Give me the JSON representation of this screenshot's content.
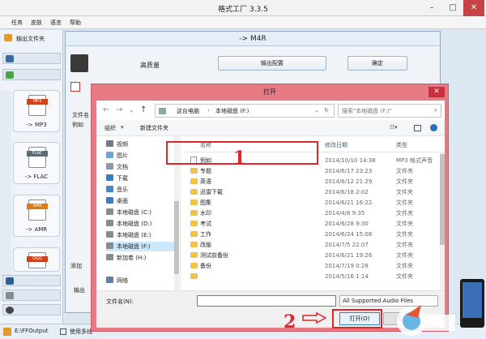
{
  "app": {
    "title": "格式工厂 3.3.5"
  },
  "menu": [
    "任务",
    "皮肤",
    "语言",
    "帮助"
  ],
  "toolbar": {
    "output_folder": "输出文件夹"
  },
  "left": {
    "formats": [
      {
        "label": "-> MP3",
        "tag": "MP3",
        "color": "#d0421b"
      },
      {
        "label": "-> FLAC",
        "tag": "FLAC",
        "color": "#5a6b7a"
      },
      {
        "label": "-> AMR",
        "tag": "AMR",
        "color": "#e07a10"
      },
      {
        "label": "OGG",
        "tag": "OGG",
        "color": "#d0421b"
      }
    ]
  },
  "m4r": {
    "title": "-> M4R",
    "quality_label": "高质量",
    "output_settings_btn": "输出配置",
    "ok_btn": "确定",
    "file_name_label": "文件名",
    "file_item": "例如",
    "add_label": "添加",
    "output_label": "输出"
  },
  "open_dialog": {
    "title": "打开",
    "close": "✕",
    "address": {
      "pc": "这台电脑",
      "drive": "本地磁盘 (F:)"
    },
    "search_placeholder": "搜索\"本地磁盘 (F:)\"",
    "organize": "组织",
    "new_folder": "新建文件夹",
    "nav": [
      {
        "label": "视频",
        "color": "#6d7b8c"
      },
      {
        "label": "图片",
        "color": "#6aa7d6"
      },
      {
        "label": "文档",
        "color": "#8a9aa9"
      },
      {
        "label": "下载",
        "color": "#3a7fc6"
      },
      {
        "label": "音乐",
        "color": "#4a86c8"
      },
      {
        "label": "桌面",
        "color": "#3d7cc4"
      },
      {
        "label": "本地磁盘 (C:)",
        "color": "#8c8c8c"
      },
      {
        "label": "本地磁盘 (D:)",
        "color": "#8c8c8c"
      },
      {
        "label": "本地磁盘 (E:)",
        "color": "#8c8c8c"
      },
      {
        "label": "本地磁盘 (F:)",
        "color": "#8c8c8c"
      },
      {
        "label": "新加卷 (H:)",
        "color": "#8c8c8c"
      },
      {
        "label": "网络",
        "color": "#5b7fa6"
      }
    ],
    "columns": {
      "name": "名称",
      "date": "修改日期",
      "type": "类型"
    },
    "rows": [
      {
        "name": "例如",
        "date": "2014/10/10 14:38",
        "type": "MP3 格式声音",
        "kind": "file"
      },
      {
        "name": "专题",
        "date": "2014/6/17 23:23",
        "type": "文件夹",
        "kind": "folder"
      },
      {
        "name": "英语",
        "date": "2014/6/12 21:29",
        "type": "文件夹",
        "kind": "folder"
      },
      {
        "name": "迅雷下载",
        "date": "2014/6/18 2:02",
        "type": "文件夹",
        "kind": "folder"
      },
      {
        "name": "图集",
        "date": "2014/6/21 16:22",
        "type": "文件夹",
        "kind": "folder"
      },
      {
        "name": "水印",
        "date": "2014/4/8 9:35",
        "type": "文件夹",
        "kind": "folder"
      },
      {
        "name": "考试",
        "date": "2014/6/28 9:30",
        "type": "文件夹",
        "kind": "folder"
      },
      {
        "name": "工作",
        "date": "2014/6/24 15:08",
        "type": "文件夹",
        "kind": "folder"
      },
      {
        "name": "改版",
        "date": "2014/7/5 22:07",
        "type": "文件夹",
        "kind": "folder"
      },
      {
        "name": "测试前备份",
        "date": "2014/6/21 19:26",
        "type": "文件夹",
        "kind": "folder"
      },
      {
        "name": "备份",
        "date": "2014/7/19 0:28",
        "type": "文件夹",
        "kind": "folder"
      },
      {
        "name": "",
        "date": "2014/5/16 1:14",
        "type": "文件夹",
        "kind": "folder"
      }
    ],
    "filename_label": "文件名(N):",
    "filename_value": "",
    "filter": "All Supported Audio Files",
    "open_btn": "打开(O)",
    "cancel_btn": "取消"
  },
  "annotations": {
    "one": "1",
    "two": "2"
  },
  "status": {
    "path": "E:\\FFOutput",
    "use_multi": "使用多线"
  }
}
